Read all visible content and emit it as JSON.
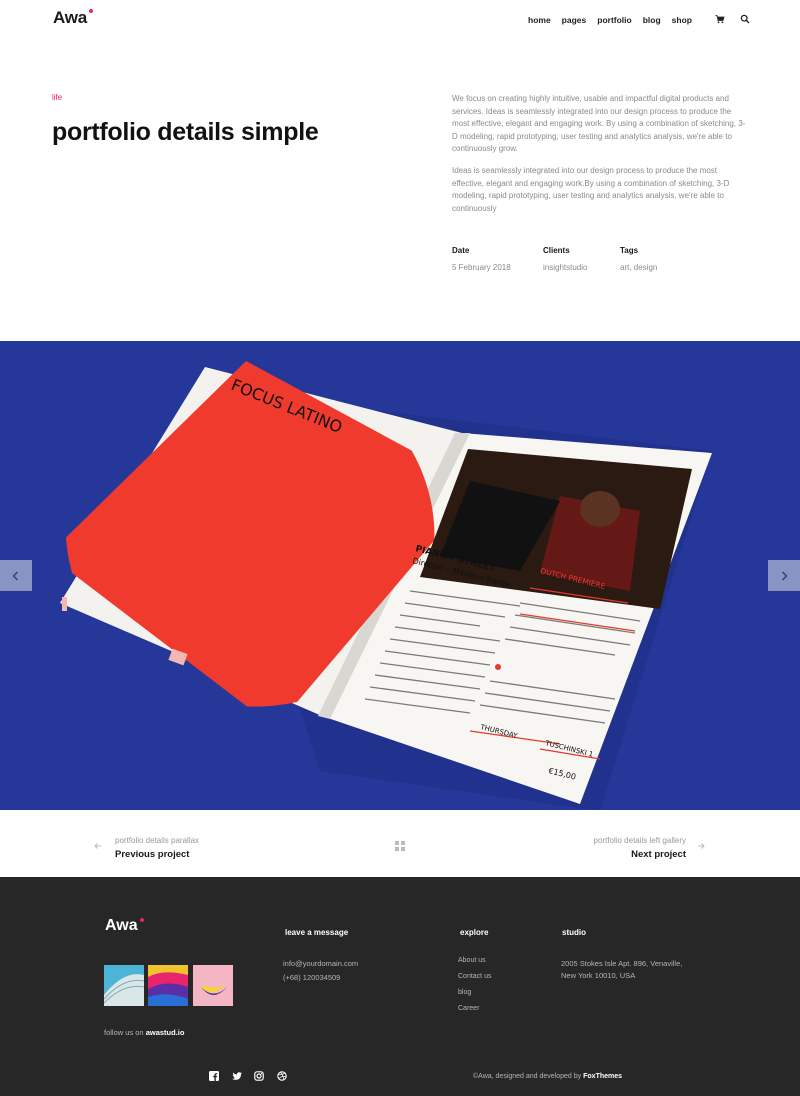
{
  "header": {
    "logo": "Awa",
    "nav": [
      "home",
      "pages",
      "portfolio",
      "blog",
      "shop"
    ],
    "active_nav": "portfolio",
    "icons": [
      "cart-icon",
      "search-icon"
    ]
  },
  "intro": {
    "category": "life",
    "title": "portfolio details simple",
    "paragraph_1": "We focus on creating highly intuitive, usable and impactful digital products and services. Ideas is seamlessly integrated into our design process to produce the most effective, elegant and engaging work. By using a combination of sketching, 3-D modeling, rapid prototyping, user testing and analytics analysis, we're able to continuously grow.",
    "paragraph_2": "Ideas is seamlessly integrated into our design process to produce the most effective, elegant and engaging work.By using a combination of sketching, 3-D modeling, rapid prototyping, user testing and analytics analysis, we're able to continuously",
    "meta": [
      {
        "label": "Date",
        "value": "5 February 2018"
      },
      {
        "label": "Clients",
        "value": "insightstudio"
      },
      {
        "label": "Tags",
        "value": "art, design"
      }
    ]
  },
  "hero": {
    "bg_color": "#26379a",
    "magazine": {
      "left_title": "FOCUS LATINO",
      "left_text": "A showcase of the best and newest Latin American films from this year, with a focus on new talent from the countries in Latin America cinema.",
      "heading": "PIANIST STREET",
      "subheading": "CALLE DE LOS PIANISTAS",
      "director": "Director – Mariano Nante",
      "cast": "Cast – Natasha Binder, Karin Lechner",
      "info": "Argentina, Belgium | 2015 | 90 min",
      "lang": "Spanish, English, French with English Subtitles",
      "badge": "DUTCH PREMIERE",
      "thursday": "THURSDAY",
      "date": "26.05.16",
      "ticket": "TICKET PRICE",
      "venue": "TUSCHINSKI 1",
      "time": "21.00",
      "price": "€15,00"
    }
  },
  "project_nav": {
    "prev_small": "portfolio details parallax",
    "prev_big": "Previous project",
    "next_small": "portfolio details left gallery",
    "next_big": "Next project"
  },
  "footer": {
    "logo": "Awa",
    "follow_prefix": "follow us on ",
    "follow_handle": "awastud.io",
    "col_message": {
      "title": "leave a message",
      "email": "info@yourdomain.com",
      "phone": "(+68) 120034509"
    },
    "col_explore": {
      "title": "explore",
      "links": [
        "About us",
        "Contact us",
        "blog",
        "Career"
      ]
    },
    "col_studio": {
      "title": "studio",
      "address_1": "2005 Stokes Isle Apt. 896, Venaville,",
      "address_2": "New York 10010, USA"
    },
    "copyright_prefix": "©Awa, designed and developed by ",
    "copyright_brand": "FoxThemes",
    "social_icons": [
      "facebook-icon",
      "twitter-icon",
      "instagram-icon",
      "dribbble-icon"
    ]
  },
  "colors": {
    "accent": "#e8246f",
    "highlight": "#f5dd3a",
    "footer_bg": "#272727",
    "hero_red": "#f03a2e"
  }
}
